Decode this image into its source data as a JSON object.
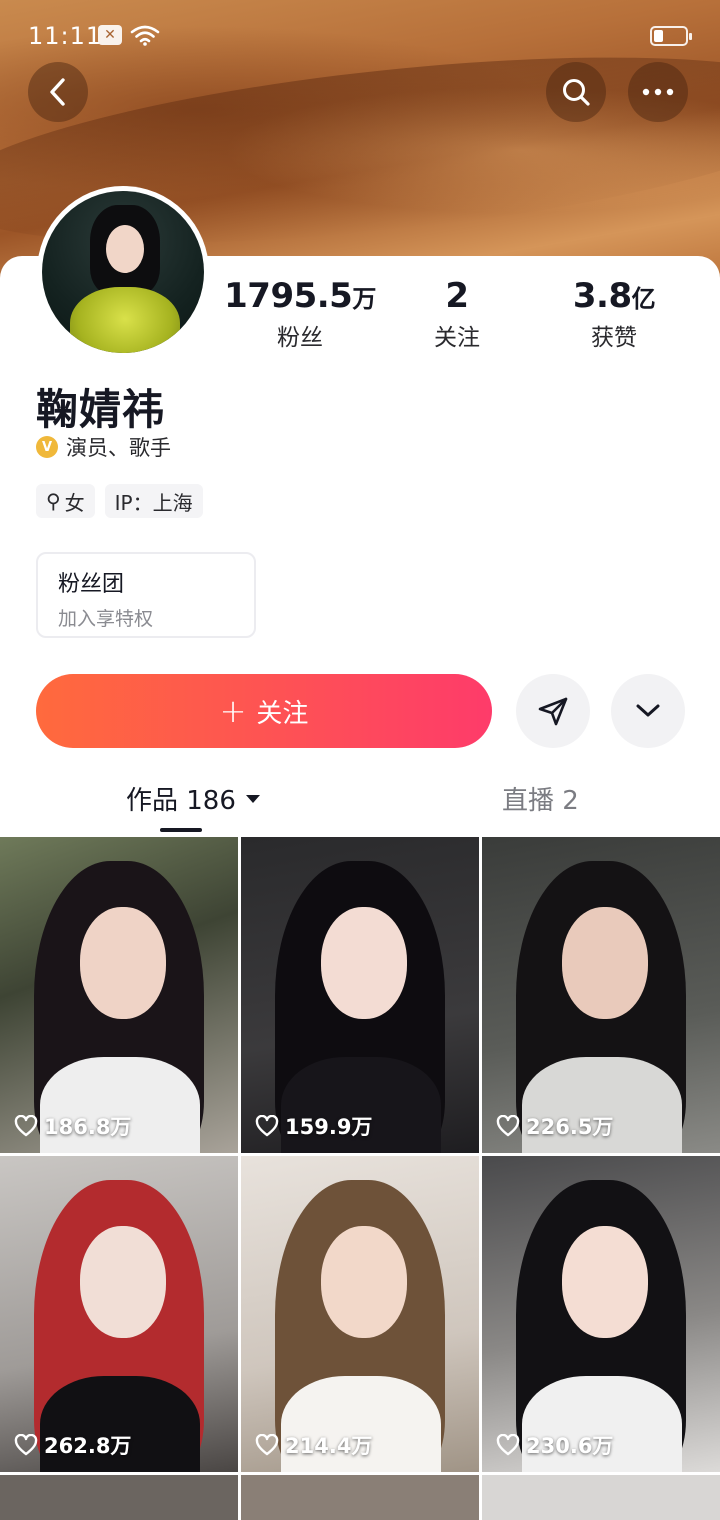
{
  "status_bar": {
    "time": "11:11"
  },
  "profile": {
    "name": "鞠婧祎",
    "verification": "演员、歌手",
    "tags": [
      {
        "icon": "female-icon",
        "label": "女"
      },
      {
        "label": "IP：上海"
      }
    ],
    "fan_club": {
      "title": "粉丝团",
      "subtitle": "加入享特权"
    }
  },
  "stats": [
    {
      "value": "1795.5",
      "unit": "万",
      "label": "粉丝"
    },
    {
      "value": "2",
      "unit": "",
      "label": "关注"
    },
    {
      "value": "3.8",
      "unit": "亿",
      "label": "获赞"
    }
  ],
  "actions": {
    "follow_label": "关注"
  },
  "tabs": [
    {
      "label": "作品 186",
      "selected": true
    },
    {
      "label": "直播 2",
      "selected": false
    }
  ],
  "videos": [
    {
      "likes": "186.8万"
    },
    {
      "likes": "159.9万"
    },
    {
      "likes": "226.5万"
    },
    {
      "likes": "262.8万"
    },
    {
      "likes": "214.4万"
    },
    {
      "likes": "230.6万"
    }
  ],
  "colors": {
    "accent_start": "#ff6a3d",
    "accent_end": "#fe3b6a",
    "text": "#161823",
    "muted": "#7b7c82"
  }
}
